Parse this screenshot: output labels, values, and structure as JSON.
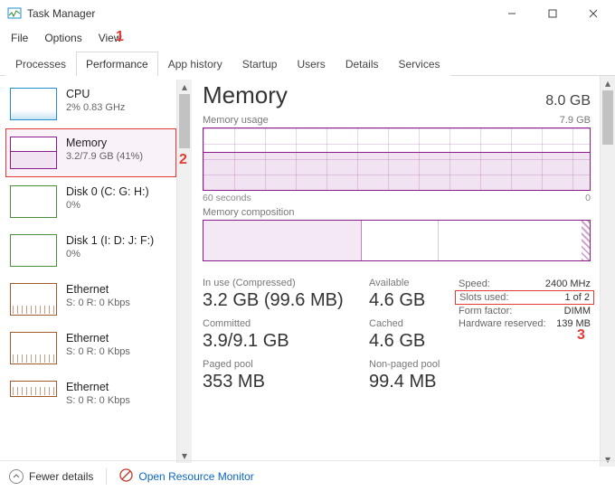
{
  "window": {
    "title": "Task Manager"
  },
  "menubar": [
    "File",
    "Options",
    "View"
  ],
  "tabs": [
    "Processes",
    "Performance",
    "App history",
    "Startup",
    "Users",
    "Details",
    "Services"
  ],
  "active_tab": 1,
  "sidebar": [
    {
      "name": "CPU",
      "sub": "2% 0.83 GHz",
      "kind": "cpu"
    },
    {
      "name": "Memory",
      "sub": "3.2/7.9 GB (41%)",
      "kind": "mem"
    },
    {
      "name": "Disk 0 (C: G: H:)",
      "sub": "0%",
      "kind": "disk"
    },
    {
      "name": "Disk 1 (I: D: J: F:)",
      "sub": "0%",
      "kind": "disk"
    },
    {
      "name": "Ethernet",
      "sub": "S: 0  R: 0 Kbps",
      "kind": "eth"
    },
    {
      "name": "Ethernet",
      "sub": "S: 0  R: 0 Kbps",
      "kind": "eth"
    },
    {
      "name": "Ethernet",
      "sub": "S: 0  R: 0 Kbps",
      "kind": "eth"
    }
  ],
  "sidebar_selected": 1,
  "header": {
    "title": "Memory",
    "capacity": "8.0 GB"
  },
  "usage_graph": {
    "label": "Memory usage",
    "right_label": "7.9 GB",
    "x_left": "60 seconds",
    "x_right": "0"
  },
  "comp_graph": {
    "label": "Memory composition"
  },
  "stats": {
    "in_use_label": "In use (Compressed)",
    "in_use": "3.2 GB (99.6 MB)",
    "available_label": "Available",
    "available": "4.6 GB",
    "committed_label": "Committed",
    "committed": "3.9/9.1 GB",
    "cached_label": "Cached",
    "cached": "4.6 GB",
    "paged_label": "Paged pool",
    "paged": "353 MB",
    "nonpaged_label": "Non-paged pool",
    "nonpaged": "99.4 MB"
  },
  "details": [
    {
      "k": "Speed:",
      "v": "2400 MHz",
      "hl": false
    },
    {
      "k": "Slots used:",
      "v": "1 of 2",
      "hl": true
    },
    {
      "k": "Form factor:",
      "v": "DIMM",
      "hl": false
    },
    {
      "k": "Hardware reserved:",
      "v": "139 MB",
      "hl": false
    }
  ],
  "footer": {
    "fewer": "Fewer details",
    "orm": "Open Resource Monitor"
  },
  "annotations": {
    "a1": "1",
    "a2": "2",
    "a3": "3"
  }
}
